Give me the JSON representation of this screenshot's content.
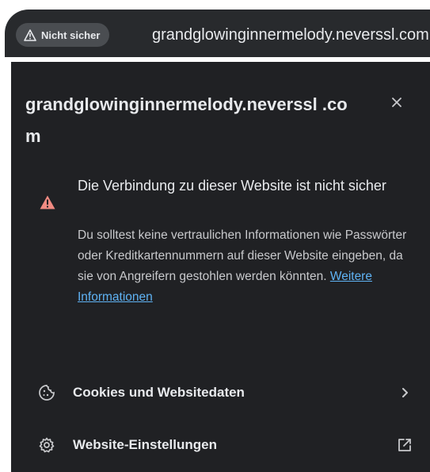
{
  "omnibox": {
    "security_chip": {
      "label": "Nicht sicher",
      "icon": "warning-triangle-icon"
    },
    "url": "grandglowinginnermelody.neverssl.com"
  },
  "popup": {
    "title": "grandglowinginnermelody.neverssl .com",
    "close_icon": "close-icon",
    "warning": {
      "icon": "warning-triangle-icon",
      "color": "#f28b82",
      "title": "Die Verbindung zu dieser Website ist nicht sicher",
      "body": "Du solltest keine vertraulichen Informationen wie Passwörter oder Kreditkartennummern auf dieser Website eingeben, da sie von Angreifern gestohlen werden könnten.",
      "link": "Weitere Informationen"
    },
    "items": [
      {
        "label": "Cookies und Websitedaten",
        "icon": "cookie-icon",
        "end_icon": "chevron-right-icon"
      },
      {
        "label": "Website-Einstellungen",
        "icon": "gear-icon",
        "end_icon": "open-in-new-icon"
      }
    ]
  },
  "colors": {
    "panel_bg": "#202124",
    "omnibox_bg": "#282a2d",
    "chip_bg": "#4a4d51",
    "text": "#e8eaed",
    "link": "#5fb3f5"
  }
}
